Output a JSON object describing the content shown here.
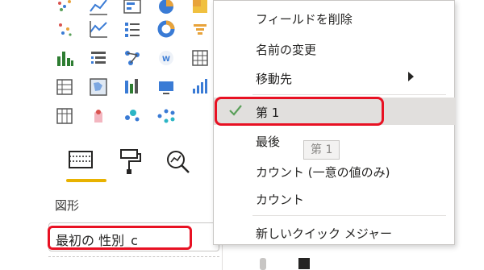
{
  "context_menu": {
    "items": [
      {
        "label": "フィールドを削除"
      },
      {
        "label": "名前の変更"
      },
      {
        "label": "移動先"
      },
      {
        "label": "第 1"
      },
      {
        "label": "最後"
      },
      {
        "label": "カウント (一意の値のみ)"
      },
      {
        "label": "カウント"
      },
      {
        "label": "新しいクイック メジャー"
      }
    ],
    "selected": "第 1",
    "submenu_icon": "chevron-right-icon",
    "check_icon": "checkmark-icon"
  },
  "tooltip": {
    "text": "第 1"
  },
  "viz_pane": {
    "icons": [
      "scatter-icon",
      "line-chart-icon",
      "table-visual-icon",
      "pie-chart-icon",
      "treemap-icon",
      "stacked-column-icon",
      "slicer-list-icon",
      "key-influencers-icon",
      "word-icon",
      "matrix-icon",
      "table-grid-icon",
      "shape-map-icon",
      "bar-chart-icon",
      "card-visual-icon",
      "kpi-icon",
      "matrix-icon-2",
      "r-visual-icon",
      "scatter-bubble-icon",
      "decomposition-icon"
    ],
    "tabs": [
      "fields-tab-icon",
      "format-paintroller-icon",
      "analytics-magnify-icon"
    ],
    "section_label": "図形",
    "field_well_value": "最初の 性別_c"
  },
  "colors": {
    "accent_yellow": "#e8b200",
    "highlight_red": "#e81123",
    "menu_selected_bg": "#e1dfdd",
    "check_green": "#5aa05a"
  }
}
